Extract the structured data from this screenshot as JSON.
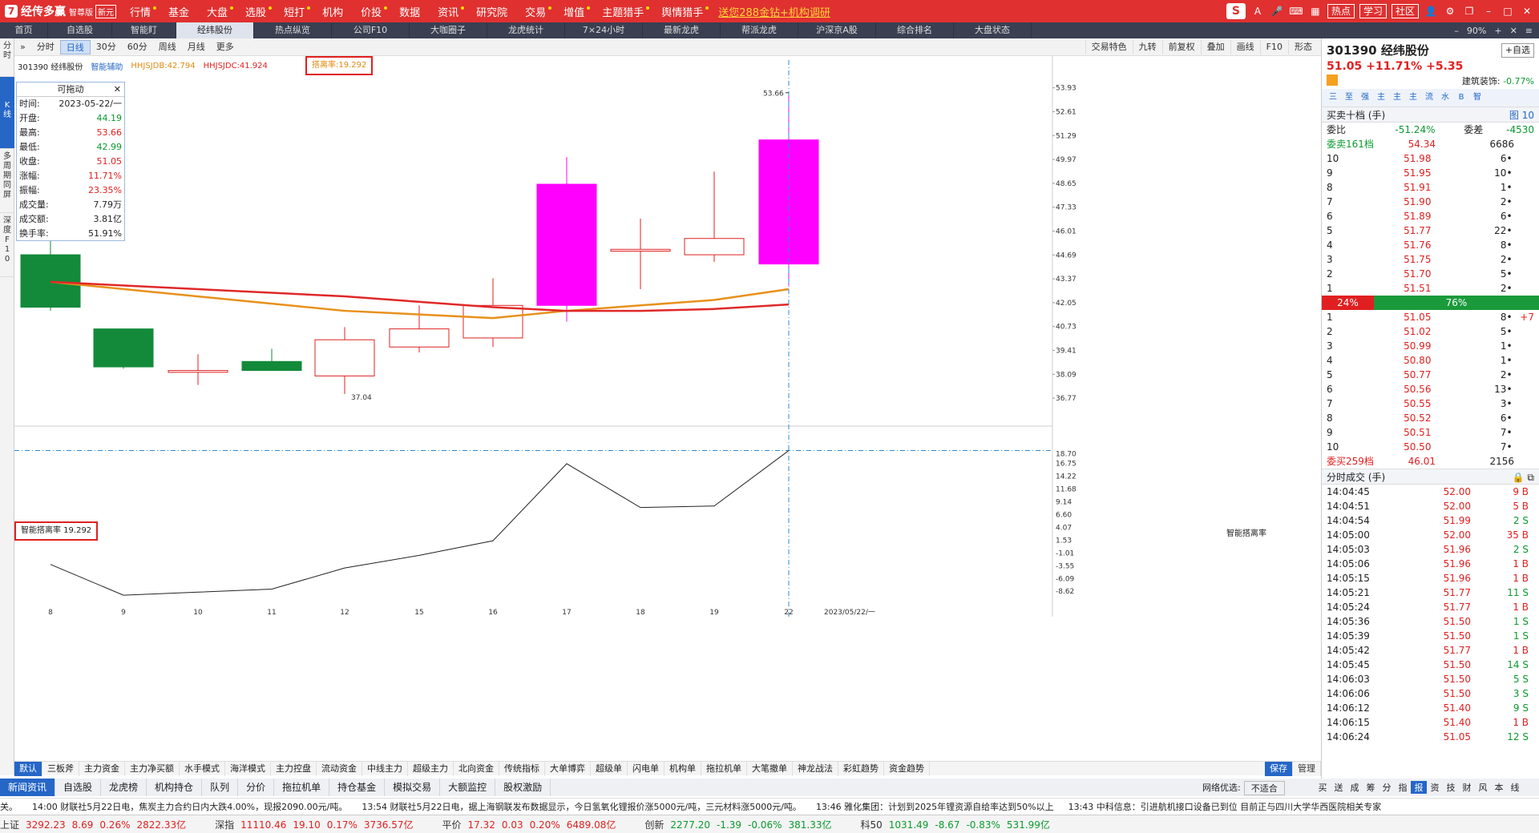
{
  "app": {
    "logo": "经传多赢",
    "edition": "智尊版",
    "edition2": "新元",
    "promo": "送您288金钻+机构调研",
    "menu": [
      {
        "label": "行情",
        "dot": true
      },
      {
        "label": "基金",
        "dot": false
      },
      {
        "label": "大盘",
        "dot": true
      },
      {
        "label": "选股",
        "dot": true
      },
      {
        "label": "短打",
        "dot": true
      },
      {
        "label": "机构",
        "dot": false
      },
      {
        "label": "价投",
        "dot": true
      },
      {
        "label": "数据",
        "dot": false
      },
      {
        "label": "资讯",
        "dot": true
      },
      {
        "label": "研究院",
        "dot": false
      },
      {
        "label": "交易",
        "dot": true
      },
      {
        "label": "增值",
        "dot": true
      },
      {
        "label": "主题猎手",
        "dot": true
      },
      {
        "label": "舆情猎手",
        "dot": true
      }
    ],
    "right_pills": [
      "热点",
      "学习",
      "社区"
    ],
    "window": {
      "min": "–",
      "max": "□",
      "close": "✕"
    }
  },
  "tabs": [
    "首页",
    "自选股",
    "智能盯盘",
    "经纬股份",
    "热点纵览",
    "公司F10",
    "大咖圈子",
    "龙虎统计",
    "7×24小时",
    "最新龙虎",
    "帮派龙虎",
    "沪深京A股",
    "综合排名",
    "大盘状态"
  ],
  "zoom": "90%",
  "left_tabs": [
    "分时",
    "K线",
    "多周期同屏",
    "深度F10"
  ],
  "toolbar": {
    "left": [
      "分时",
      "日线",
      "30分",
      "60分",
      "周线",
      "月线",
      "更多"
    ],
    "right": [
      "交易特色",
      "九转",
      "前复权",
      "叠加",
      "画线",
      "F10",
      "形态"
    ]
  },
  "chart": {
    "stock_label": "301390 经纬股份",
    "assist": "智能辅助",
    "hhjsjdb": "HHJSJDB:42.794",
    "hhjsjdc": "HHJSJDC:41.924",
    "deviation": "搭离率:19.292",
    "ind_label": "智能搭离率  19.292",
    "ind_label_right": "智能搭离率",
    "high_mark": "53.66",
    "low_mark": "37.04",
    "price_ticks": [
      "53.93",
      "52.61",
      "51.29",
      "49.97",
      "48.65",
      "47.33",
      "46.01",
      "44.69",
      "43.37",
      "42.05",
      "40.73",
      "39.41",
      "38.09",
      "36.77"
    ],
    "ind_ticks": [
      "18.70",
      "16.75",
      "14.22",
      "11.68",
      "9.14",
      "6.60",
      "4.07",
      "1.53",
      "-1.01",
      "-3.55",
      "-6.09",
      "-8.62"
    ],
    "date_bottom": "2023/05/22/一"
  },
  "infobox": {
    "title": "可拖动",
    "close": "✕",
    "rows": [
      {
        "k": "时间:",
        "v": "2023-05-22/一",
        "c": "#222"
      },
      {
        "k": "开盘:",
        "v": "44.19",
        "c": "#0a9a2e"
      },
      {
        "k": "最高:",
        "v": "53.66",
        "c": "#e02020"
      },
      {
        "k": "最低:",
        "v": "42.99",
        "c": "#0a9a2e"
      },
      {
        "k": "收盘:",
        "v": "51.05",
        "c": "#e02020"
      },
      {
        "k": "涨幅:",
        "v": "11.71%",
        "c": "#e02020"
      },
      {
        "k": "振幅:",
        "v": "23.35%",
        "c": "#e02020"
      },
      {
        "k": "成交量:",
        "v": "7.79万",
        "c": "#222"
      },
      {
        "k": "成交额:",
        "v": "3.81亿",
        "c": "#222"
      },
      {
        "k": "换手率:",
        "v": "51.91%",
        "c": "#222"
      }
    ]
  },
  "chart_data": {
    "type": "candlestick",
    "x": [
      "8",
      "9",
      "10",
      "11",
      "12",
      "15",
      "16",
      "17",
      "18",
      "19",
      "22"
    ],
    "ohlc": [
      [
        44.7,
        41.8,
        41.6,
        47.5
      ],
      [
        40.6,
        38.5,
        38.4,
        40.6
      ],
      [
        38.2,
        38.3,
        37.5,
        39.2
      ],
      [
        38.8,
        38.3,
        38.3,
        39.5
      ],
      [
        38.0,
        40.0,
        37.0,
        40.7
      ],
      [
        39.6,
        40.6,
        39.3,
        41.9
      ],
      [
        40.1,
        41.9,
        39.6,
        43.4
      ],
      [
        41.9,
        48.6,
        41.0,
        50.1
      ],
      [
        44.9,
        45.0,
        42.8,
        46.7
      ],
      [
        44.7,
        45.6,
        44.3,
        49.3
      ],
      [
        44.19,
        51.05,
        42.99,
        53.66
      ]
    ],
    "colors": [
      "#138a3a",
      "#138a3a",
      "#e02020",
      "#138a3a",
      "#e02020",
      "#e02020",
      "#e02020",
      "#ff00ff",
      "#e02020",
      "#e02020",
      "#ff00ff"
    ],
    "ma1": [
      43.2,
      null,
      null,
      null,
      42.4,
      null,
      41.8,
      41.6,
      41.6,
      41.7,
      41.95
    ],
    "ma2": [
      43.2,
      null,
      null,
      null,
      41.6,
      null,
      41.2,
      41.6,
      41.9,
      42.2,
      42.8
    ],
    "ylim": [
      36.2,
      54.8
    ],
    "indicator": {
      "values": [
        -3.3,
        -9.4,
        -8.8,
        -8.2,
        -4.0,
        -1.5,
        1.4,
        16.7,
        8.0,
        8.3,
        19.3
      ],
      "ylim": [
        -10.5,
        20.5
      ]
    }
  },
  "indicator_tabs": [
    "默认",
    "三板斧",
    "主力资金",
    "主力净买额",
    "水手模式",
    "海洋模式",
    "主力控盘",
    "流动资金",
    "中线主力",
    "超级主力",
    "北向资金",
    "传统指标",
    "大单博弈",
    "超级单",
    "闪电单",
    "机构单",
    "拖拉机单",
    "大笔撤单",
    "神龙战法",
    "彩虹趋势",
    "资金趋势"
  ],
  "indicator_tabs_right": [
    "保存",
    "管理"
  ],
  "news_tabs": [
    "新闻资讯",
    "自选股",
    "龙虎榜",
    "机构持仓",
    "队列",
    "分价",
    "拖拉机单",
    "持仓基金",
    "模拟交易",
    "大额监控",
    "股权激励"
  ],
  "net_opt": {
    "label": "网络优选:",
    "value": "不适合"
  },
  "bottom_right_tabs": [
    "买",
    "送",
    "成",
    "筹",
    "分",
    "指",
    "报",
    "资",
    "技",
    "财",
    "风",
    "本",
    "线"
  ],
  "ticker": [
    "关。",
    "14:00 财联社5月22日电，焦炭主力合约日内大跌4.00%，现报2090.00元/吨。",
    "13:54 财联社5月22日电，据上海钢联发布数据显示，今日氢氧化锂报价涨5000元/吨，三元材料涨5000元/吨。",
    "13:46 雅化集团：计划到2025年锂资源自给率达到50%以上",
    "13:43 中科信息：引进航机接口设备已到位 目前正与四川大学华西医院相关专家"
  ],
  "indices": [
    {
      "name": "上证",
      "v": "3292.23",
      "c": "8.69",
      "p": "0.26%",
      "a": "2822.33亿",
      "color": "#e02020"
    },
    {
      "name": "深指",
      "v": "11110.46",
      "c": "19.10",
      "p": "0.17%",
      "a": "3736.57亿",
      "color": "#e02020"
    },
    {
      "name": "平价",
      "v": "17.32",
      "c": "0.03",
      "p": "0.20%",
      "a": "6489.08亿",
      "color": "#e02020"
    },
    {
      "name": "创新",
      "v": "2277.20",
      "c": "-1.39",
      "p": "-0.06%",
      "a": "381.33亿",
      "color": "#0a9a2e"
    },
    {
      "name": "科50",
      "v": "1031.49",
      "c": "-8.67",
      "p": "-0.83%",
      "a": "531.99亿",
      "color": "#0a9a2e"
    }
  ],
  "right": {
    "code": "301390 经纬股份",
    "add": "+自选",
    "price": "51.05",
    "change": "+11.71%",
    "amount": "+5.35",
    "sector": "建筑装饰:",
    "sector_chg": "-0.77%",
    "icons": [
      "三",
      "至",
      "强",
      "主",
      "主",
      "主",
      "流",
      "水",
      "B",
      "智"
    ],
    "orderbook_title": "买卖十档 (手)",
    "ob_opts": [
      "图",
      "10"
    ],
    "webi": {
      "k": "委比",
      "v": "-51.24%",
      "k2": "委差",
      "v2": "-4530"
    },
    "sell_head": {
      "k": "委卖161档",
      "p": "54.34",
      "v": "6686"
    },
    "sells": [
      {
        "l": "10",
        "p": "51.98",
        "v": "6",
        "c": ""
      },
      {
        "l": "9",
        "p": "51.95",
        "v": "10",
        "c": ""
      },
      {
        "l": "8",
        "p": "51.91",
        "v": "1",
        "c": ""
      },
      {
        "l": "7",
        "p": "51.90",
        "v": "2",
        "c": ""
      },
      {
        "l": "6",
        "p": "51.89",
        "v": "6",
        "c": ""
      },
      {
        "l": "5",
        "p": "51.77",
        "v": "22",
        "c": ""
      },
      {
        "l": "4",
        "p": "51.76",
        "v": "8",
        "c": ""
      },
      {
        "l": "3",
        "p": "51.75",
        "v": "2",
        "c": ""
      },
      {
        "l": "2",
        "p": "51.70",
        "v": "5",
        "c": ""
      },
      {
        "l": "1",
        "p": "51.51",
        "v": "2",
        "c": ""
      }
    ],
    "bar": {
      "left": "24%",
      "right": "76%",
      "left_pct": 24
    },
    "buys": [
      {
        "l": "1",
        "p": "51.05",
        "v": "8",
        "c": "+7"
      },
      {
        "l": "2",
        "p": "51.02",
        "v": "5",
        "c": ""
      },
      {
        "l": "3",
        "p": "50.99",
        "v": "1",
        "c": ""
      },
      {
        "l": "4",
        "p": "50.80",
        "v": "1",
        "c": ""
      },
      {
        "l": "5",
        "p": "50.77",
        "v": "2",
        "c": ""
      },
      {
        "l": "6",
        "p": "50.56",
        "v": "13",
        "c": ""
      },
      {
        "l": "7",
        "p": "50.55",
        "v": "3",
        "c": ""
      },
      {
        "l": "8",
        "p": "50.52",
        "v": "6",
        "c": ""
      },
      {
        "l": "9",
        "p": "50.51",
        "v": "7",
        "c": ""
      },
      {
        "l": "10",
        "p": "50.50",
        "v": "7",
        "c": ""
      }
    ],
    "buy_head": {
      "k": "委买259档",
      "p": "46.01",
      "v": "2156"
    },
    "trades_title": "分时成交 (手)",
    "trades": [
      {
        "t": "14:04:45",
        "p": "52.00",
        "v": "9 B"
      },
      {
        "t": "14:04:51",
        "p": "52.00",
        "v": "5 B"
      },
      {
        "t": "14:04:54",
        "p": "51.99",
        "v": "2 S"
      },
      {
        "t": "14:05:00",
        "p": "52.00",
        "v": "35 B"
      },
      {
        "t": "14:05:03",
        "p": "51.96",
        "v": "2 S"
      },
      {
        "t": "14:05:06",
        "p": "51.96",
        "v": "1 B"
      },
      {
        "t": "14:05:15",
        "p": "51.96",
        "v": "1 B"
      },
      {
        "t": "14:05:21",
        "p": "51.77",
        "v": "11 S"
      },
      {
        "t": "14:05:24",
        "p": "51.77",
        "v": "1 B"
      },
      {
        "t": "14:05:36",
        "p": "51.50",
        "v": "1 S"
      },
      {
        "t": "14:05:39",
        "p": "51.50",
        "v": "1 S"
      },
      {
        "t": "14:05:42",
        "p": "51.77",
        "v": "1 B"
      },
      {
        "t": "14:05:45",
        "p": "51.50",
        "v": "14 S"
      },
      {
        "t": "14:06:03",
        "p": "51.50",
        "v": "5 S"
      },
      {
        "t": "14:06:06",
        "p": "51.50",
        "v": "3 S"
      },
      {
        "t": "14:06:12",
        "p": "51.40",
        "v": "9 S"
      },
      {
        "t": "14:06:15",
        "p": "51.40",
        "v": "1 B"
      },
      {
        "t": "14:06:24",
        "p": "51.05",
        "v": "12 S"
      }
    ]
  }
}
